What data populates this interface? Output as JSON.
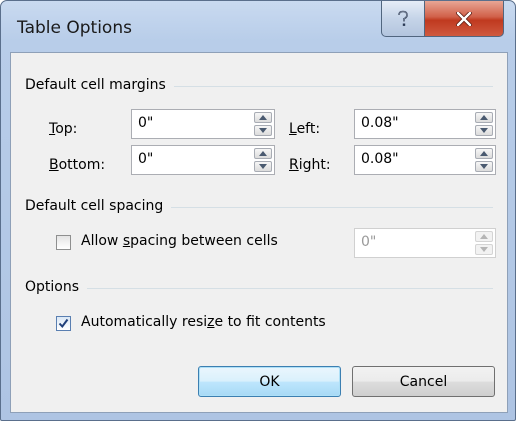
{
  "dialog": {
    "title": "Table Options"
  },
  "margins": {
    "section_label": "Default cell margins",
    "top": {
      "label_u": "T",
      "label_rest": "op:",
      "value": "0\""
    },
    "bottom": {
      "label_u": "B",
      "label_rest": "ottom:",
      "value": "0\""
    },
    "left": {
      "label_u": "L",
      "label_rest": "eft:",
      "value": "0.08\""
    },
    "right": {
      "label_u": "R",
      "label_rest": "ight:",
      "value": "0.08\""
    }
  },
  "spacing": {
    "section_label": "Default cell spacing",
    "checkbox_pre": "Allow ",
    "checkbox_u": "s",
    "checkbox_post": "pacing between cells",
    "checked": false,
    "value": "0\""
  },
  "options": {
    "section_label": "Options",
    "checkbox_pre": "Automatically resi",
    "checkbox_u": "z",
    "checkbox_post": "e to fit contents",
    "checked": true
  },
  "buttons": {
    "ok": "OK",
    "cancel": "Cancel"
  },
  "colors": {
    "title_bar": "#b8cde9",
    "client_bg": "#f0f0f0",
    "close_button": "#c0391f",
    "default_button_border": "#3c7fb1"
  },
  "icons": {
    "help": "question-mark",
    "close": "x-mark",
    "check": "checkmark",
    "spin_up": "triangle-up",
    "spin_down": "triangle-down"
  }
}
